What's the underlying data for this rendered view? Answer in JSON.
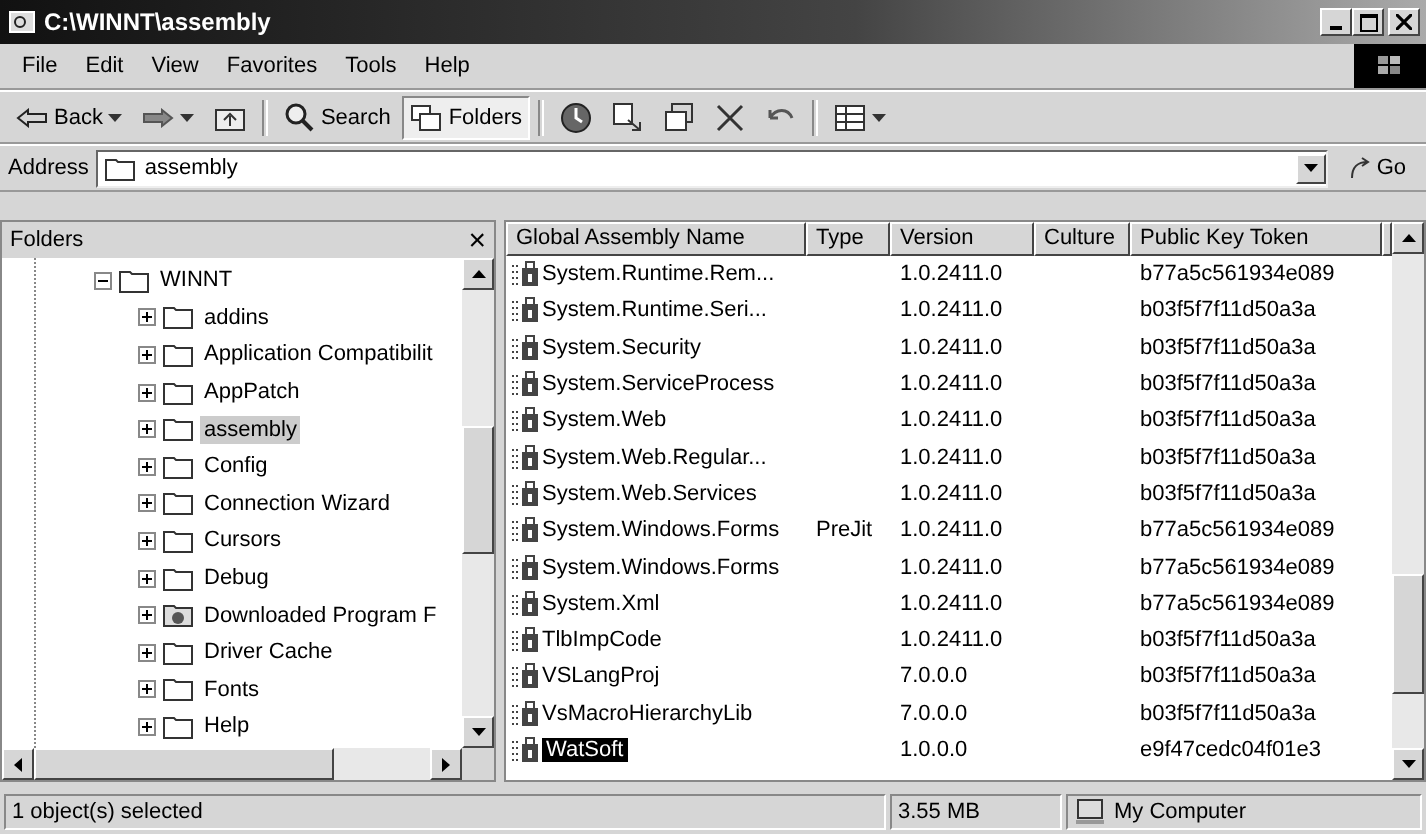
{
  "window": {
    "title": "C:\\WINNT\\assembly"
  },
  "menu": [
    "File",
    "Edit",
    "View",
    "Favorites",
    "Tools",
    "Help"
  ],
  "toolbar": [
    {
      "kind": "back",
      "label": "Back",
      "selected": false
    },
    {
      "kind": "forward",
      "selected": false
    },
    {
      "kind": "up",
      "selected": false
    },
    {
      "kind": "search",
      "label": "Search",
      "selected": false
    },
    {
      "kind": "folders",
      "label": "Folders",
      "selected": true
    },
    {
      "kind": "history",
      "selected": false
    },
    {
      "kind": "moveto",
      "selected": false
    },
    {
      "kind": "copyto",
      "selected": false
    },
    {
      "kind": "delete",
      "selected": false
    },
    {
      "kind": "undo",
      "selected": false
    },
    {
      "kind": "views",
      "selected": false
    }
  ],
  "address": {
    "label": "Address",
    "value": "assembly",
    "go": "Go"
  },
  "folders_pane": {
    "title": "Folders",
    "close": "×",
    "tree": [
      {
        "label": "WINNT",
        "expanded": true,
        "selected": false,
        "kind": "folder",
        "children": [
          {
            "label": "addins",
            "expanded": false,
            "selected": false,
            "kind": "folder"
          },
          {
            "label": "Application Compatibilit",
            "expanded": false,
            "selected": false,
            "kind": "folder"
          },
          {
            "label": "AppPatch",
            "expanded": false,
            "selected": false,
            "kind": "folder"
          },
          {
            "label": "assembly",
            "expanded": false,
            "selected": true,
            "kind": "folder"
          },
          {
            "label": "Config",
            "expanded": false,
            "selected": false,
            "kind": "folder"
          },
          {
            "label": "Connection Wizard",
            "expanded": false,
            "selected": false,
            "kind": "folder"
          },
          {
            "label": "Cursors",
            "expanded": false,
            "selected": false,
            "kind": "folder"
          },
          {
            "label": "Debug",
            "expanded": false,
            "selected": false,
            "kind": "folder"
          },
          {
            "label": "Downloaded Program F",
            "expanded": false,
            "selected": false,
            "kind": "special"
          },
          {
            "label": "Driver Cache",
            "expanded": false,
            "selected": false,
            "kind": "folder"
          },
          {
            "label": "Fonts",
            "expanded": false,
            "selected": false,
            "kind": "folder"
          },
          {
            "label": "Help",
            "expanded": false,
            "selected": false,
            "kind": "folder"
          }
        ]
      }
    ]
  },
  "table": {
    "columns": [
      "Global Assembly Name",
      "Type",
      "Version",
      "Culture",
      "Public Key Token"
    ],
    "rows": [
      {
        "cells": [
          "System.Runtime.Rem...",
          "",
          "1.0.2411.0",
          "",
          "b77a5c561934e089"
        ],
        "selected": false
      },
      {
        "cells": [
          "System.Runtime.Seri...",
          "",
          "1.0.2411.0",
          "",
          "b03f5f7f11d50a3a"
        ],
        "selected": false
      },
      {
        "cells": [
          "System.Security",
          "",
          "1.0.2411.0",
          "",
          "b03f5f7f11d50a3a"
        ],
        "selected": false
      },
      {
        "cells": [
          "System.ServiceProcess",
          "",
          "1.0.2411.0",
          "",
          "b03f5f7f11d50a3a"
        ],
        "selected": false
      },
      {
        "cells": [
          "System.Web",
          "",
          "1.0.2411.0",
          "",
          "b03f5f7f11d50a3a"
        ],
        "selected": false
      },
      {
        "cells": [
          "System.Web.Regular...",
          "",
          "1.0.2411.0",
          "",
          "b03f5f7f11d50a3a"
        ],
        "selected": false
      },
      {
        "cells": [
          "System.Web.Services",
          "",
          "1.0.2411.0",
          "",
          "b03f5f7f11d50a3a"
        ],
        "selected": false
      },
      {
        "cells": [
          "System.Windows.Forms",
          "PreJit",
          "1.0.2411.0",
          "",
          "b77a5c561934e089"
        ],
        "selected": false
      },
      {
        "cells": [
          "System.Windows.Forms",
          "",
          "1.0.2411.0",
          "",
          "b77a5c561934e089"
        ],
        "selected": false
      },
      {
        "cells": [
          "System.Xml",
          "",
          "1.0.2411.0",
          "",
          "b77a5c561934e089"
        ],
        "selected": false
      },
      {
        "cells": [
          "TlbImpCode",
          "",
          "1.0.2411.0",
          "",
          "b03f5f7f11d50a3a"
        ],
        "selected": false
      },
      {
        "cells": [
          "VSLangProj",
          "",
          "7.0.0.0",
          "",
          "b03f5f7f11d50a3a"
        ],
        "selected": false
      },
      {
        "cells": [
          "VsMacroHierarchyLib",
          "",
          "7.0.0.0",
          "",
          "b03f5f7f11d50a3a"
        ],
        "selected": false
      },
      {
        "cells": [
          "WatSoft",
          "",
          "1.0.0.0",
          "",
          "e9f47cedc04f01e3"
        ],
        "selected": true
      }
    ]
  },
  "status_bar": {
    "message": "1 object(s) selected",
    "size": "3.55 MB",
    "zone": "My Computer"
  }
}
